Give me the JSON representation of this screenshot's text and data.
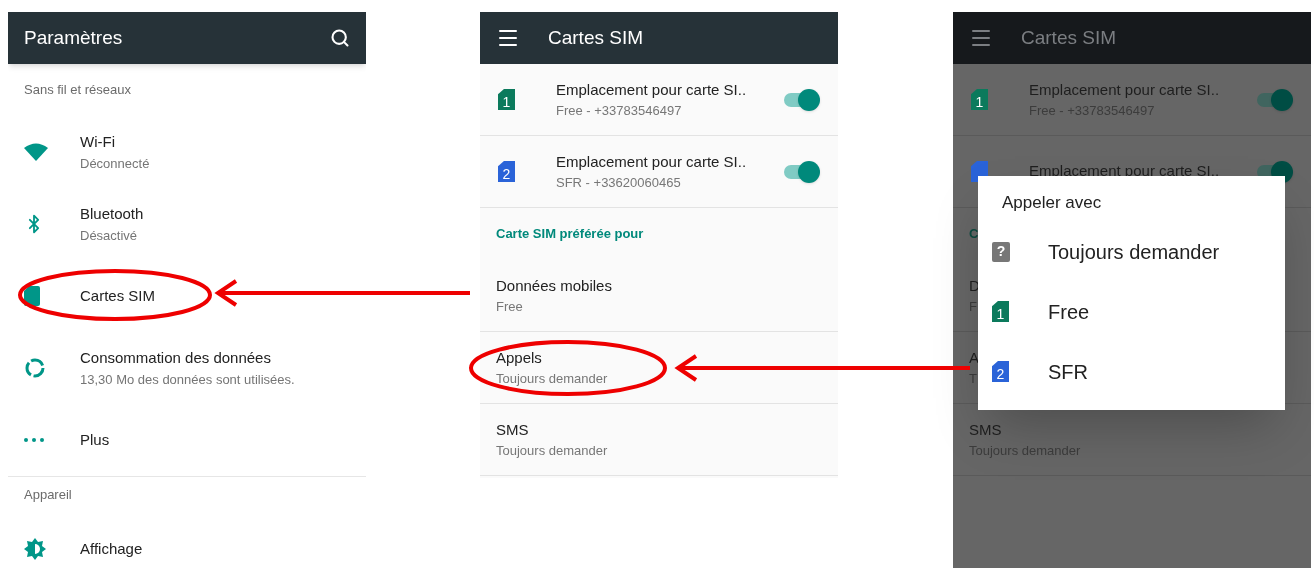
{
  "screens": [
    {
      "kind": "settings",
      "title": "Paramètres",
      "sections": [
        {
          "header": "Sans fil et réseaux",
          "items": [
            {
              "kind": "wifi",
              "title": "Wi-Fi",
              "subtitle": "Déconnecté"
            },
            {
              "kind": "bluetooth",
              "title": "Bluetooth",
              "subtitle": "Désactivé"
            },
            {
              "kind": "sim",
              "title": "Cartes SIM"
            },
            {
              "kind": "data",
              "title": "Consommation des données",
              "subtitle": "13,30 Mo des données sont utilisées."
            },
            {
              "kind": "more",
              "title": "Plus"
            }
          ]
        },
        {
          "header": "Appareil",
          "items": [
            {
              "kind": "display",
              "title": "Affichage"
            }
          ]
        }
      ]
    },
    {
      "kind": "sim",
      "dimmed": false,
      "title": "Cartes SIM",
      "sim_slots": [
        {
          "number": "1",
          "color": "#0b7a5c",
          "title": "Emplacement pour carte SI..",
          "subtitle": "Free - +33783546497",
          "on": true
        },
        {
          "number": "2",
          "color": "#2a63d8",
          "title": "Emplacement pour carte SI..",
          "subtitle": "SFR - +33620060465",
          "on": true
        }
      ],
      "section_header": "Carte SIM préférée pour",
      "preferences": [
        {
          "title": "Données mobiles",
          "subtitle": "Free"
        },
        {
          "title": "Appels",
          "subtitle": "Toujours demander"
        },
        {
          "title": "SMS",
          "subtitle": "Toujours demander"
        }
      ]
    },
    {
      "kind": "sim",
      "dimmed": true,
      "title": "Cartes SIM",
      "sim_slots": [
        {
          "number": "1",
          "color": "#0b7a5c",
          "title": "Emplacement pour carte SI..",
          "subtitle": "Free - +33783546497",
          "on": true
        },
        {
          "color": "#2a63d8",
          "title": "Emplacement pour carte SI..",
          "on": true
        }
      ],
      "section_header": "C",
      "preferences": [
        {
          "title": "D",
          "subtitle": "F"
        },
        {
          "title": "A",
          "subtitle": "T"
        },
        {
          "title": "SMS",
          "subtitle": "Toujours demander"
        }
      ],
      "dialog": {
        "title": "Appeler avec",
        "options": [
          {
            "kind": "ask",
            "glyph": "?",
            "label": "Toujours demander"
          },
          {
            "kind": "sim",
            "glyph": "1",
            "color": "#0b7a5c",
            "label": "Free"
          },
          {
            "kind": "sim",
            "glyph": "2",
            "color": "#2a63d8",
            "label": "SFR"
          }
        ]
      }
    }
  ]
}
